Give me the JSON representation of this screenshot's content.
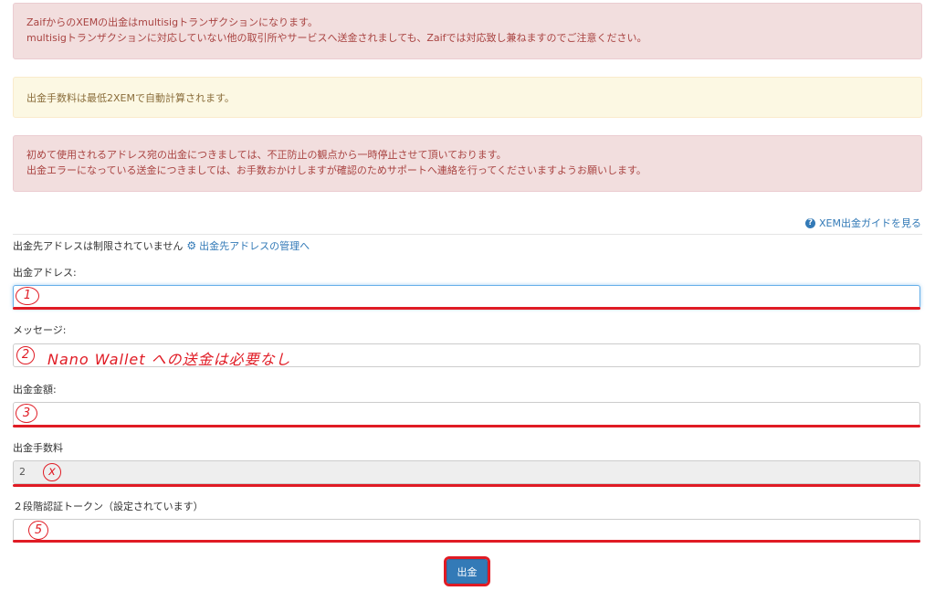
{
  "alerts": {
    "multisig_line1": "ZaifからのXEMの出金はmultisigトランザクションになります。",
    "multisig_line2": "multisigトランザクションに対応していない他の取引所やサービスへ送金されましても、Zaifでは対応致し兼ねますのでご注意ください。",
    "fee_note": "出金手数料は最低2XEMで自動計算されます。",
    "first_use_line1": "初めて使用されるアドレス宛の出金につきましては、不正防止の観点から一時停止させて頂いております。",
    "first_use_line2": "出金エラーになっている送金につきましては、お手数おかけしますが確認のためサポートへ連絡を行ってくださいますようお願いします。"
  },
  "guide_link": "XEM出金ガイドを見る",
  "address_restriction": {
    "text": "出金先アドレスは制限されていません",
    "manage_link": "出金先アドレスの管理へ"
  },
  "form": {
    "address_label": "出金アドレス:",
    "message_label": "メッセージ:",
    "amount_label": "出金金額:",
    "fee_label": "出金手数料",
    "fee_value": "2",
    "twofa_label": "２段階認証トークン（設定されています）",
    "submit_label": "出金"
  },
  "annotations": {
    "n1": "1",
    "n2": "2",
    "n2_note": "Nano Wallet への送金は必要なし",
    "n3": "3",
    "n4": "x",
    "n5": "5"
  },
  "colors": {
    "annotation_red": "#e01b24",
    "primary": "#337ab7"
  },
  "icons": [
    "question-circle-icon",
    "gear-icon"
  ]
}
